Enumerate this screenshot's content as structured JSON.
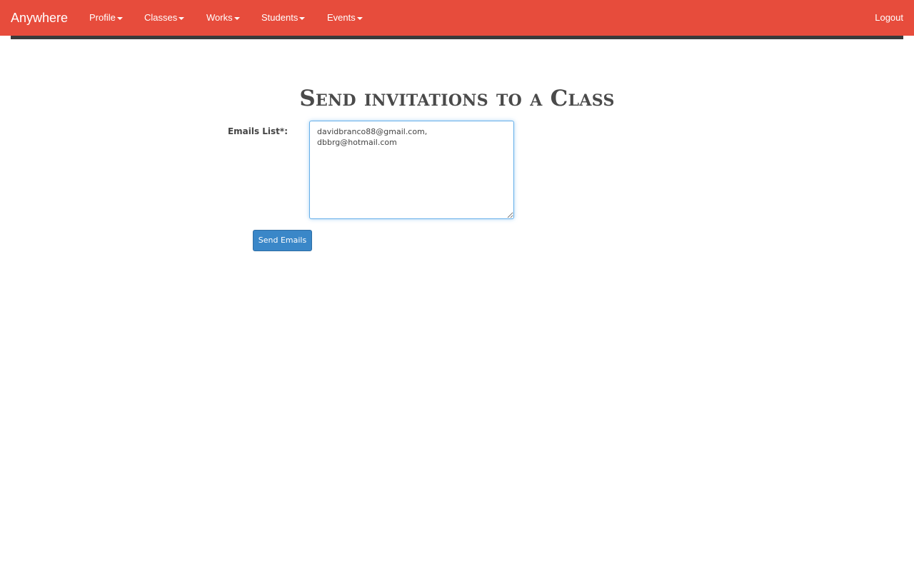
{
  "navbar": {
    "brand": "Anywhere",
    "menus": [
      {
        "label": "Profile"
      },
      {
        "label": "Classes"
      },
      {
        "label": "Works"
      },
      {
        "label": "Students"
      },
      {
        "label": "Events"
      }
    ],
    "logout_label": "Logout"
  },
  "page": {
    "title": "Send invitations to a Class"
  },
  "form": {
    "emails_label": "Emails List*:",
    "emails_value": "davidbranco88@gmail.com, dbbrg@hotmail.com",
    "submit_label": "Send Emails"
  },
  "colors": {
    "navbar": "#e74c3c",
    "navbar_underline": "#3a3a3a",
    "primary_button": "#3a87c8",
    "focus_border": "#66afe9"
  }
}
